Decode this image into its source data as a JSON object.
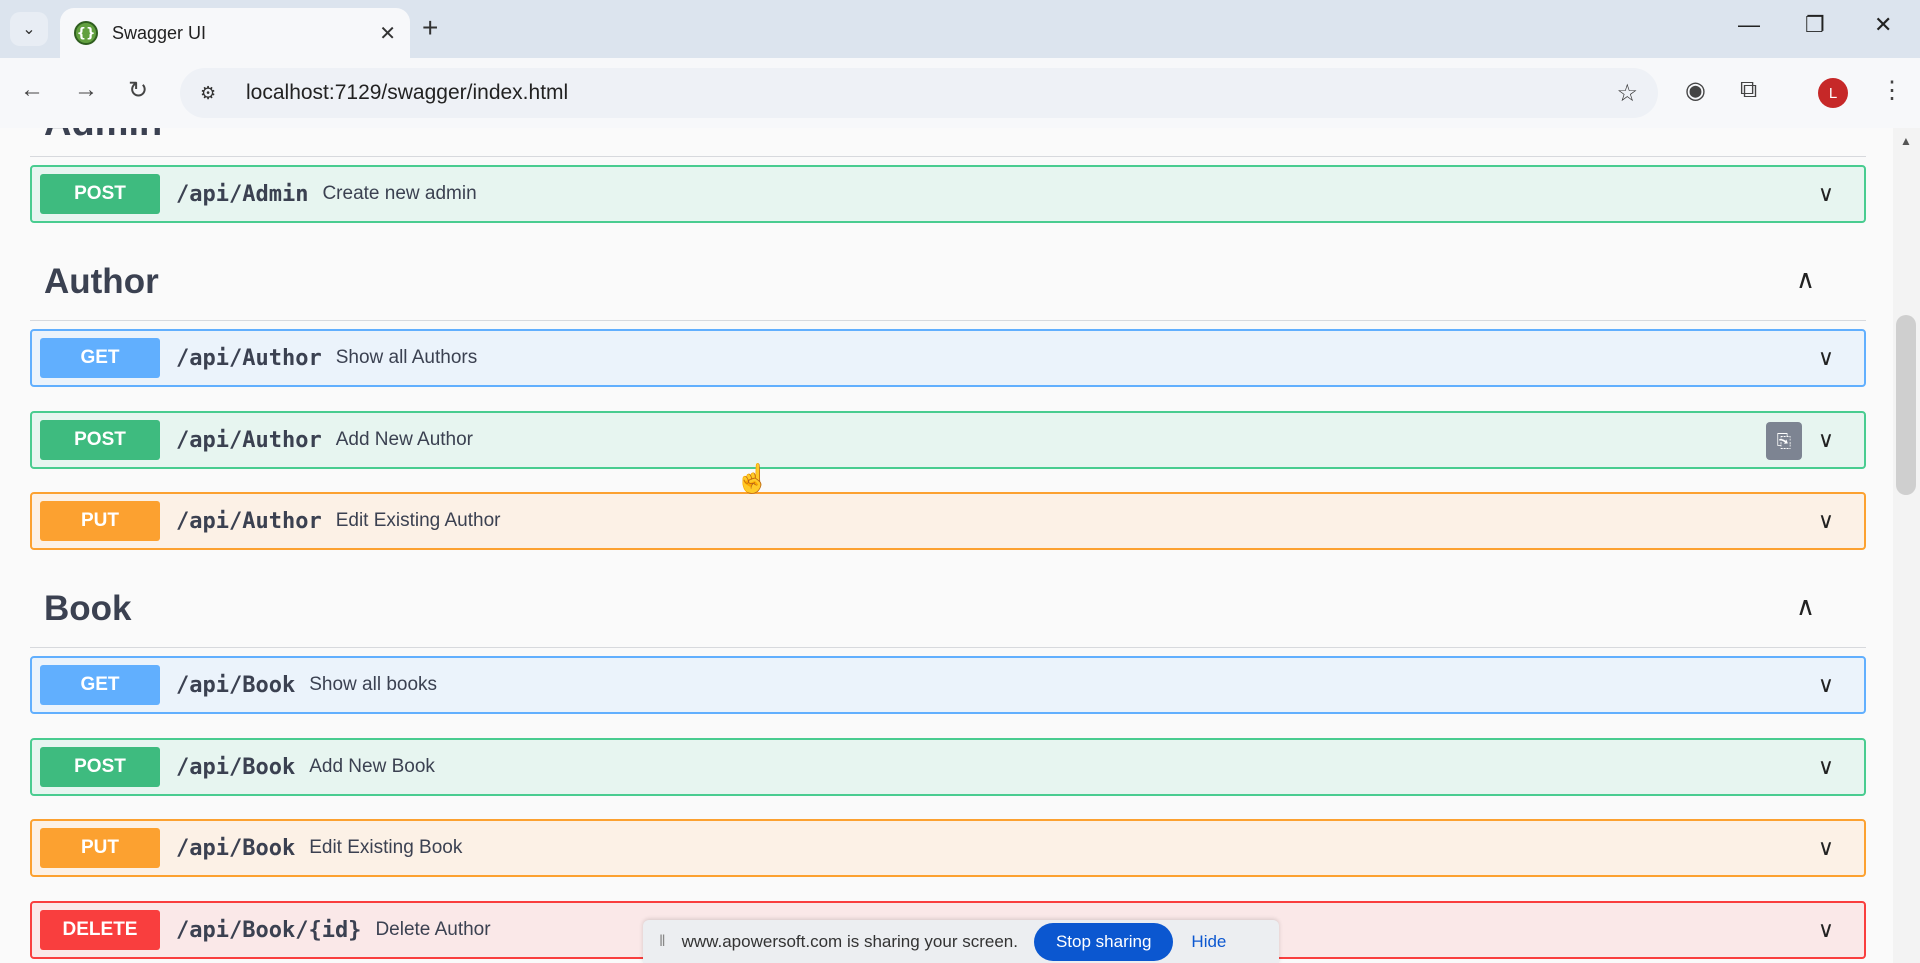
{
  "browser": {
    "tab_title": "Swagger UI",
    "tab_favicon": "{}",
    "url": "localhost:7129/swagger/index.html",
    "profile_initial": "L"
  },
  "icons": {
    "tab_search": "chevron-down-icon",
    "close_tab": "close-icon",
    "new_tab": "plus-icon",
    "back": "arrow-left-icon",
    "forward": "arrow-right-icon",
    "reload": "reload-icon",
    "site_info": "tune-icon",
    "bookmark": "star-icon",
    "extension_bot": "robot-icon",
    "extensions": "puzzle-icon",
    "menu": "kebab-icon"
  },
  "colors": {
    "post": "#49cc90",
    "get": "#61affe",
    "put": "#fca130",
    "delete": "#f93e3e"
  },
  "sections": [
    {
      "title": "Admin",
      "operations": [
        {
          "method": "POST",
          "path": "/api/Admin",
          "summary": "Create new admin"
        }
      ]
    },
    {
      "title": "Author",
      "operations": [
        {
          "method": "GET",
          "path": "/api/Author",
          "summary": "Show all Authors"
        },
        {
          "method": "POST",
          "path": "/api/Author",
          "summary": "Add New Author"
        },
        {
          "method": "PUT",
          "path": "/api/Author",
          "summary": "Edit Existing Author"
        }
      ]
    },
    {
      "title": "Book",
      "operations": [
        {
          "method": "GET",
          "path": "/api/Book",
          "summary": "Show all books"
        },
        {
          "method": "POST",
          "path": "/api/Book",
          "summary": "Add New Book"
        },
        {
          "method": "PUT",
          "path": "/api/Book",
          "summary": "Edit Existing Book"
        },
        {
          "method": "DELETE",
          "path": "/api/Book/{id}",
          "summary": "Delete Author"
        }
      ]
    }
  ],
  "share_bar": {
    "text": "www.apowersoft.com is sharing your screen.",
    "stop_label": "Stop sharing",
    "hide_label": "Hide"
  }
}
